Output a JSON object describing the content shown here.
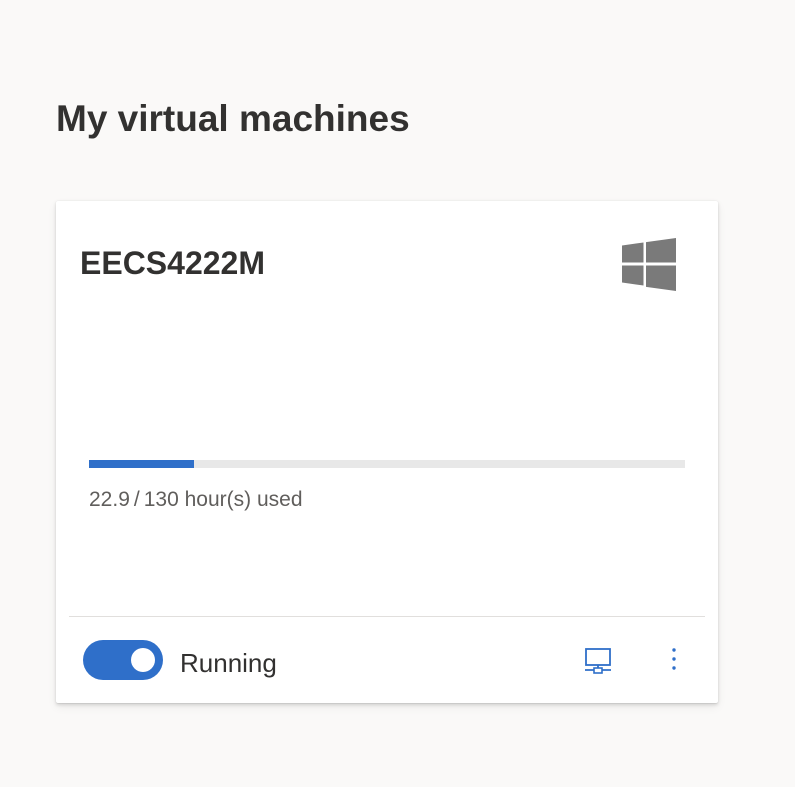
{
  "page": {
    "title": "My virtual machines"
  },
  "vm": {
    "name": "EECS4222M",
    "os_icon": "windows-logo-icon",
    "usage": {
      "used": "22.9",
      "separator": "/",
      "quota": "130",
      "suffix": "hour(s) used",
      "fraction": 0.176
    },
    "status": {
      "label": "Running",
      "toggle_on": true
    },
    "actions": {
      "connect_icon": "remote-desktop-icon",
      "more_icon": "more-vertical-icon"
    }
  },
  "colors": {
    "accent": "#2f6fc9",
    "track": "#e8e8e8",
    "os_icon": "#7a7a7a",
    "background": "#faf9f8"
  }
}
